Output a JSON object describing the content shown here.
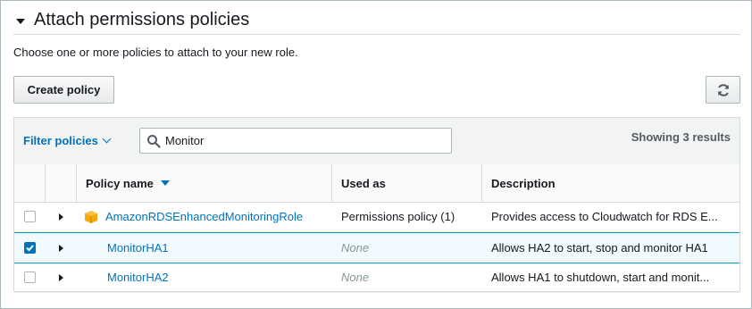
{
  "section": {
    "title": "Attach permissions policies"
  },
  "subtitle": "Choose one or more policies to attach to your new role.",
  "toolbar": {
    "create_label": "Create policy",
    "refresh_icon": "refresh-icon"
  },
  "filter": {
    "label": "Filter policies",
    "search_value": "Monitor",
    "showing": "Showing 3 results"
  },
  "columns": {
    "policy_name": "Policy name",
    "used_as": "Used as",
    "description": "Description"
  },
  "rows": [
    {
      "checked": false,
      "name": "AmazonRDSEnhancedMonitoringRole",
      "aws_managed": true,
      "used_as": "Permissions policy (1)",
      "used_as_none": false,
      "description": "Provides access to Cloudwatch for RDS E..."
    },
    {
      "checked": true,
      "name": "MonitorHA1",
      "aws_managed": false,
      "used_as": "None",
      "used_as_none": true,
      "description": "Allows HA2 to start, stop and monitor HA1"
    },
    {
      "checked": false,
      "name": "MonitorHA2",
      "aws_managed": false,
      "used_as": "None",
      "used_as_none": true,
      "description": "Allows HA1 to shutdown, start and monit..."
    }
  ],
  "colors": {
    "link": "#0073bb",
    "selected_bg": "#f1faff",
    "aws_orange": "#f7a80d"
  }
}
